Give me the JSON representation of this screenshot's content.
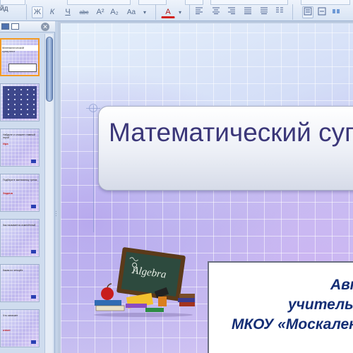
{
  "ribbon": {
    "group_label": "йд",
    "format_buttons": [
      {
        "id": "bold",
        "label": "Ж"
      },
      {
        "id": "italic",
        "label": "К"
      },
      {
        "id": "underline",
        "label": "Ч"
      },
      {
        "id": "strikethrough",
        "label": "abc"
      },
      {
        "id": "superscript",
        "label": "A²"
      },
      {
        "id": "subscript",
        "label": "A₂"
      },
      {
        "id": "font-size",
        "label": "Aa"
      },
      {
        "id": "font-color",
        "label": "A"
      }
    ]
  },
  "left_pane": {
    "thumbnails": [
      {
        "title": "Математический супертест",
        "selected": true
      },
      {
        "title": "",
        "selected": false
      },
      {
        "title": "Найдите и сложите главный герой",
        "red": "Ира",
        "selected": false
      },
      {
        "title": "Подберите математику тремя",
        "red": "Задача",
        "selected": false
      },
      {
        "title": "Как называется изменённый",
        "red": "",
        "selected": false
      },
      {
        "title": "Какая из четырёх",
        "red": "",
        "selected": false
      },
      {
        "title": "Что означает",
        "red": "ответ",
        "selected": false
      }
    ]
  },
  "slide": {
    "title": "Математический супертест",
    "author_lines": [
      "Автор",
      "учитель математики",
      "МКОУ «Москаленская СОШ»"
    ],
    "clipart_label": "Algebra"
  },
  "colors": {
    "title_text": "#3b3779",
    "author_text": "#142e75",
    "selection_border": "#f39a22"
  }
}
